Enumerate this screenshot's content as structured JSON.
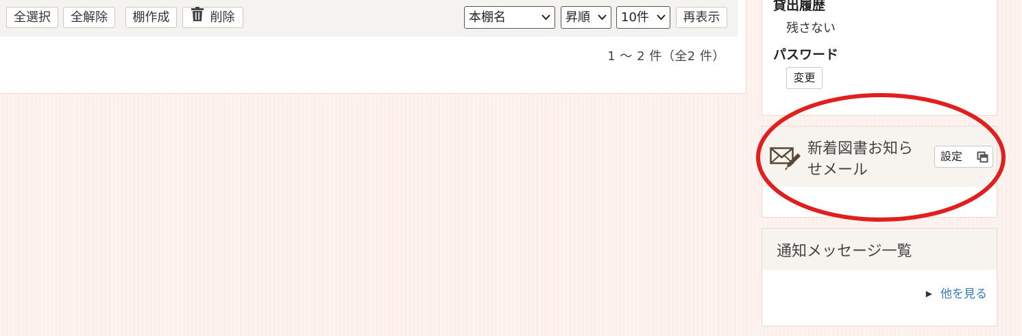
{
  "toolbar": {
    "select_all": "全選択",
    "deselect_all": "全解除",
    "create_shelf": "棚作成",
    "delete": "削除",
    "sort_key": "本棚名",
    "sort_order": "昇順",
    "per_page": "10件",
    "redisplay": "再表示"
  },
  "result_count": "1 〜 2 件（全2 件）",
  "account": {
    "history_label": "貸出履歴",
    "history_value": "残さない",
    "password_label": "パスワード",
    "change_button": "変更"
  },
  "mail_notice": {
    "title_line1": "新着図書お知ら",
    "title_line2": "せメール",
    "settings_button": "設定"
  },
  "notices": {
    "title": "通知メッセージ一覧",
    "more_link": "他を見る"
  },
  "colors": {
    "annotation_circle": "#e0201e",
    "link": "#3a7ab8"
  },
  "icons": [
    "trash-icon",
    "chevron-down-icon",
    "mail-pen-icon",
    "external-window-icon",
    "triangle-right-icon"
  ]
}
